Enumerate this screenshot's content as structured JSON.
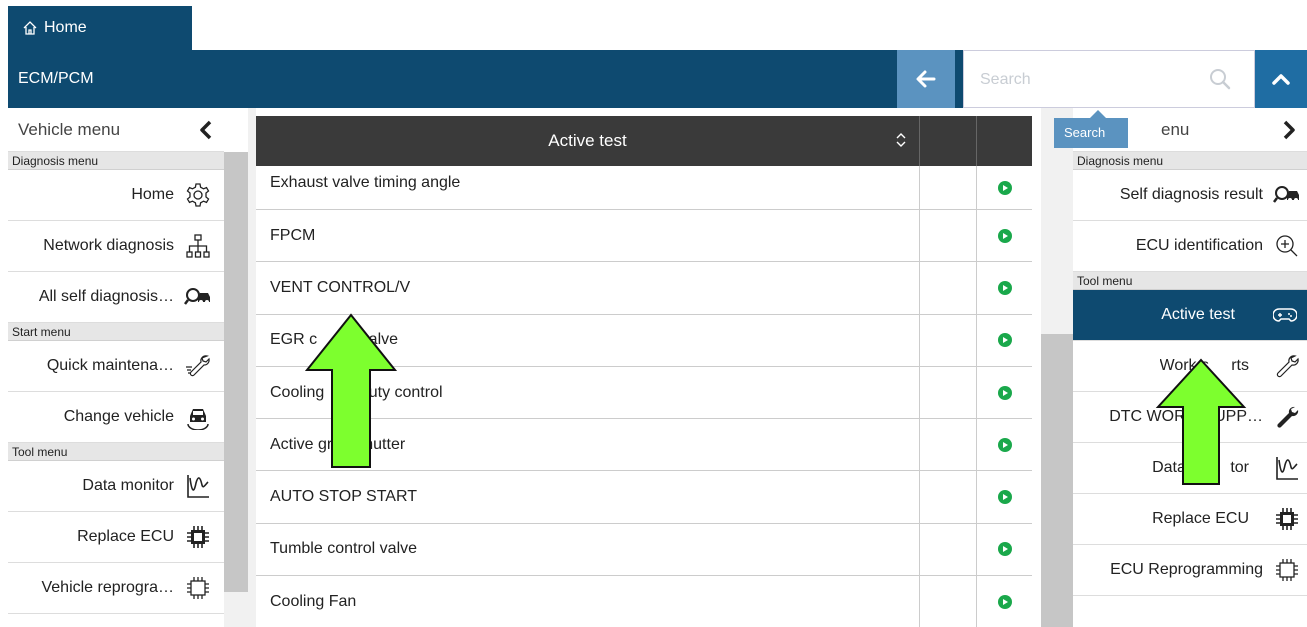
{
  "tab": {
    "label": "Home"
  },
  "titlebar": {
    "title": "ECM/PCM"
  },
  "search": {
    "placeholder": "Search",
    "tooltip": "Search"
  },
  "left_panel": {
    "header": "Vehicle menu",
    "sections": [
      {
        "label": "Diagnosis menu",
        "items": [
          {
            "label": "Home",
            "icon": "gear-icon"
          },
          {
            "label": "Network diagnosis",
            "icon": "network-icon"
          },
          {
            "label": "All self diagnosis…",
            "icon": "car-search-icon"
          }
        ]
      },
      {
        "label": "Start menu",
        "items": [
          {
            "label": "Quick maintena…",
            "icon": "quick-wrench-icon"
          },
          {
            "label": "Change vehicle",
            "icon": "car-swap-icon"
          }
        ]
      },
      {
        "label": "Tool menu",
        "items": [
          {
            "label": "Data monitor",
            "icon": "waveform-icon"
          },
          {
            "label": "Replace ECU",
            "icon": "chip-filled-icon"
          },
          {
            "label": "Vehicle reprogra…",
            "icon": "chip-outline-icon"
          }
        ]
      }
    ]
  },
  "right_panel": {
    "header": "enu",
    "sections": [
      {
        "label": "Diagnosis menu",
        "items": [
          {
            "label": "Self diagnosis result",
            "icon": "car-search-icon"
          },
          {
            "label": "ECU identification",
            "icon": "zoom-in-icon"
          }
        ]
      },
      {
        "label": "Tool menu",
        "items": [
          {
            "label": "Active test",
            "icon": "gamepad-icon",
            "active": true
          },
          {
            "label": "Work s     rts",
            "icon": "wrench-icon"
          },
          {
            "label": "DTC WORK    UPP…",
            "icon": "wrench-filled-icon"
          },
          {
            "label": "Data m      tor",
            "icon": "waveform-icon"
          },
          {
            "label": "Replace ECU",
            "icon": "chip-filled-icon"
          },
          {
            "label": "ECU Reprogramming",
            "icon": "chip-outline-icon"
          }
        ]
      }
    ]
  },
  "table": {
    "header": "Active test",
    "rows": [
      "Exhaust valve timing angle",
      "FPCM",
      "VENT CONTROL/V",
      "EGR c        l valve",
      "Cooling        duty control",
      "Active grille shutter",
      "AUTO STOP START",
      "Tumble control valve",
      "Cooling Fan"
    ]
  },
  "colors": {
    "brand": "#0e4a70",
    "accent": "#5b93c0",
    "play": "#1aa84b",
    "arrow": "#7dff2e"
  }
}
